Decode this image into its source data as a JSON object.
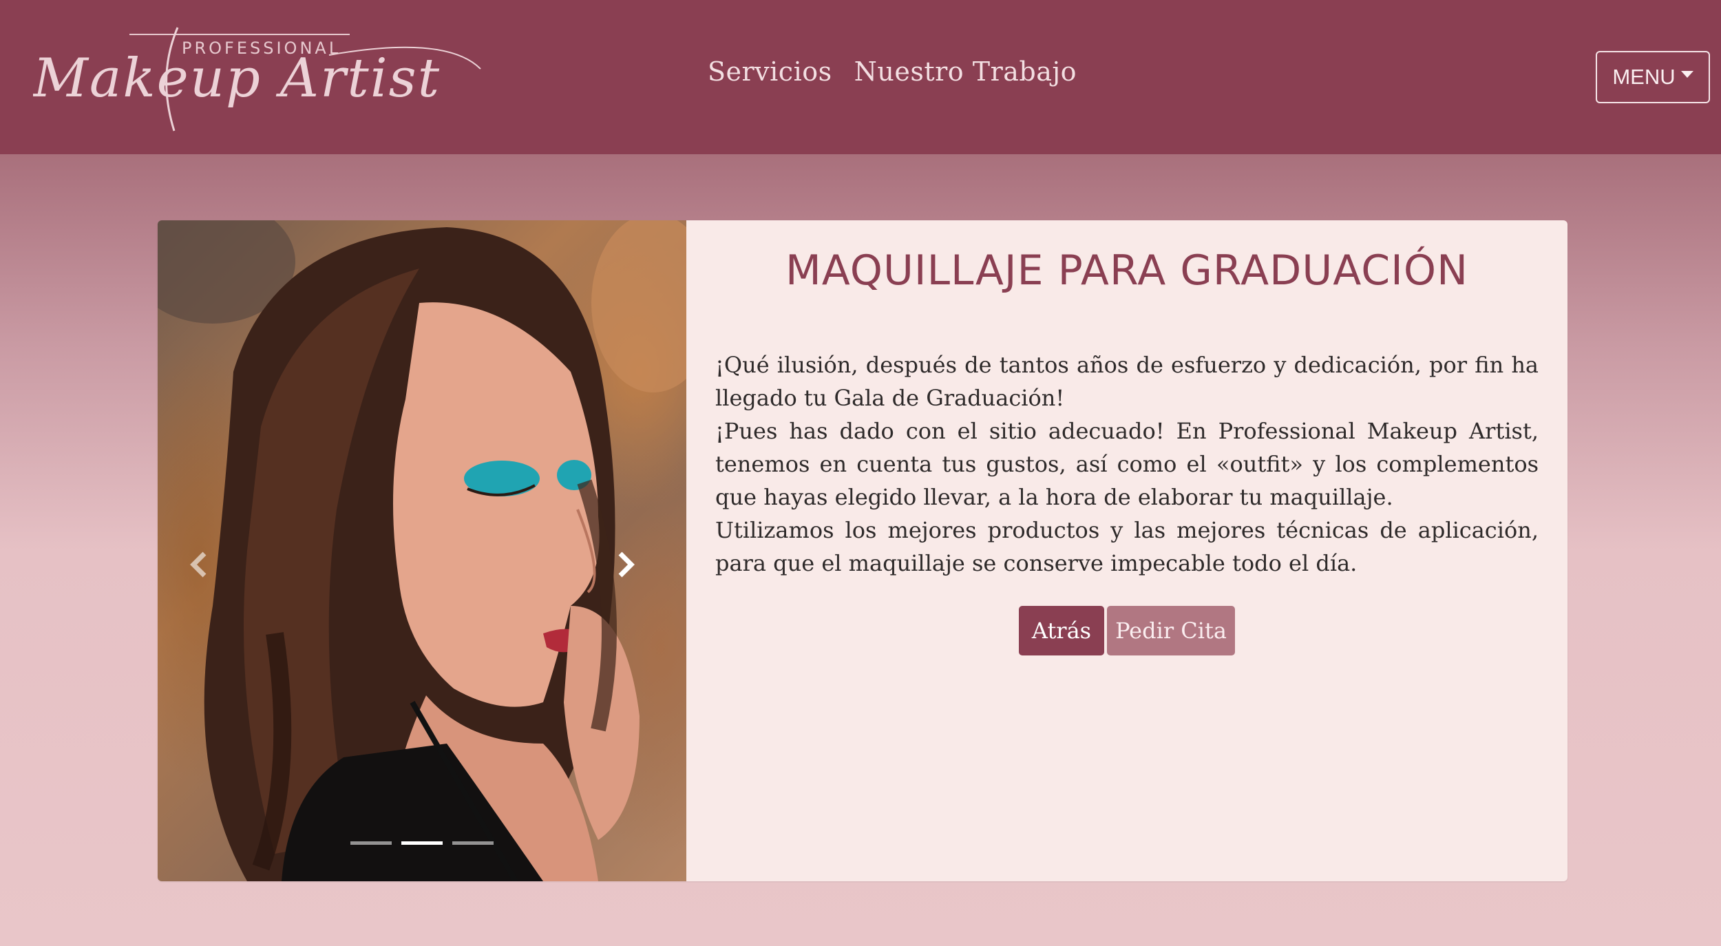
{
  "brand": {
    "logo_top": "PROFESSIONAL",
    "logo_script": "Makeup Artist"
  },
  "nav": {
    "links": [
      "Servicios",
      "Nuestro Trabajo"
    ],
    "menu_label": "MENU"
  },
  "card": {
    "title": "MAQUILLAJE PARA GRADUACIÓN",
    "paragraphs": [
      "¡Qué ilusión, después de tantos años de esfuerzo y dedicación, por fin ha llegado tu Gala de Graduación!",
      "¡Pues has dado con el sitio adecuado! En Professional Makeup Artist, tenemos en cuenta tus gustos, así como el «outfit» y los complementos que hayas elegido llevar, a la hora de elaborar tu maquillaje.",
      "Utilizamos los mejores productos y las mejores técnicas de aplicación, para que el maquillaje se conserve impecable todo el día."
    ],
    "buttons": {
      "back": "Atrás",
      "appointment": "Pedir Cita"
    }
  },
  "carousel": {
    "slides_count": 3,
    "active_index": 1,
    "prev_icon": "chevron-left-icon",
    "next_icon": "chevron-right-icon"
  },
  "colors": {
    "brand": "#8a3f52",
    "secondary_button": "#b17782",
    "card_background": "#f9eae8"
  }
}
